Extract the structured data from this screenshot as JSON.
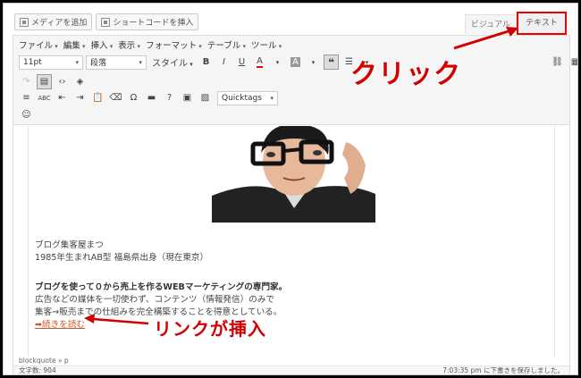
{
  "media_bar": {
    "add_media": "メディアを追加",
    "insert_shortcode": "ショートコードを挿入"
  },
  "tabs": {
    "visual": "ビジュアル",
    "text": "テキスト"
  },
  "menubar": [
    "ファイル",
    "編集",
    "挿入",
    "表示",
    "フォーマット",
    "テーブル",
    "ツール"
  ],
  "toolbar": {
    "font_size": "11pt",
    "paragraph": "段落",
    "styles": "スタイル",
    "quicktags": "Quicktags"
  },
  "content": {
    "line1": "ブログ集客屋まつ",
    "line2": "1985年生まれAB型 福島県出身（現在東京）",
    "line3": "ブログを使って０から売上を作るWEBマーケティングの専門家。",
    "line4": "広告などの媒体を一切使わず、コンテンツ（情報発信）のみで",
    "line5": "集客→販売までの仕組みを完全構築することを得意としている。",
    "link": "➡続きを読む"
  },
  "status": {
    "path": "blockquote » p",
    "word_count": "文字数: 904",
    "saved": "7:03:35 pm に下書きを保存しました。"
  },
  "annotations": {
    "click": "クリック",
    "link_inserted": "リンクが挿入"
  },
  "colors": {
    "annotation": "#d20000",
    "link": "#c85d2b"
  }
}
